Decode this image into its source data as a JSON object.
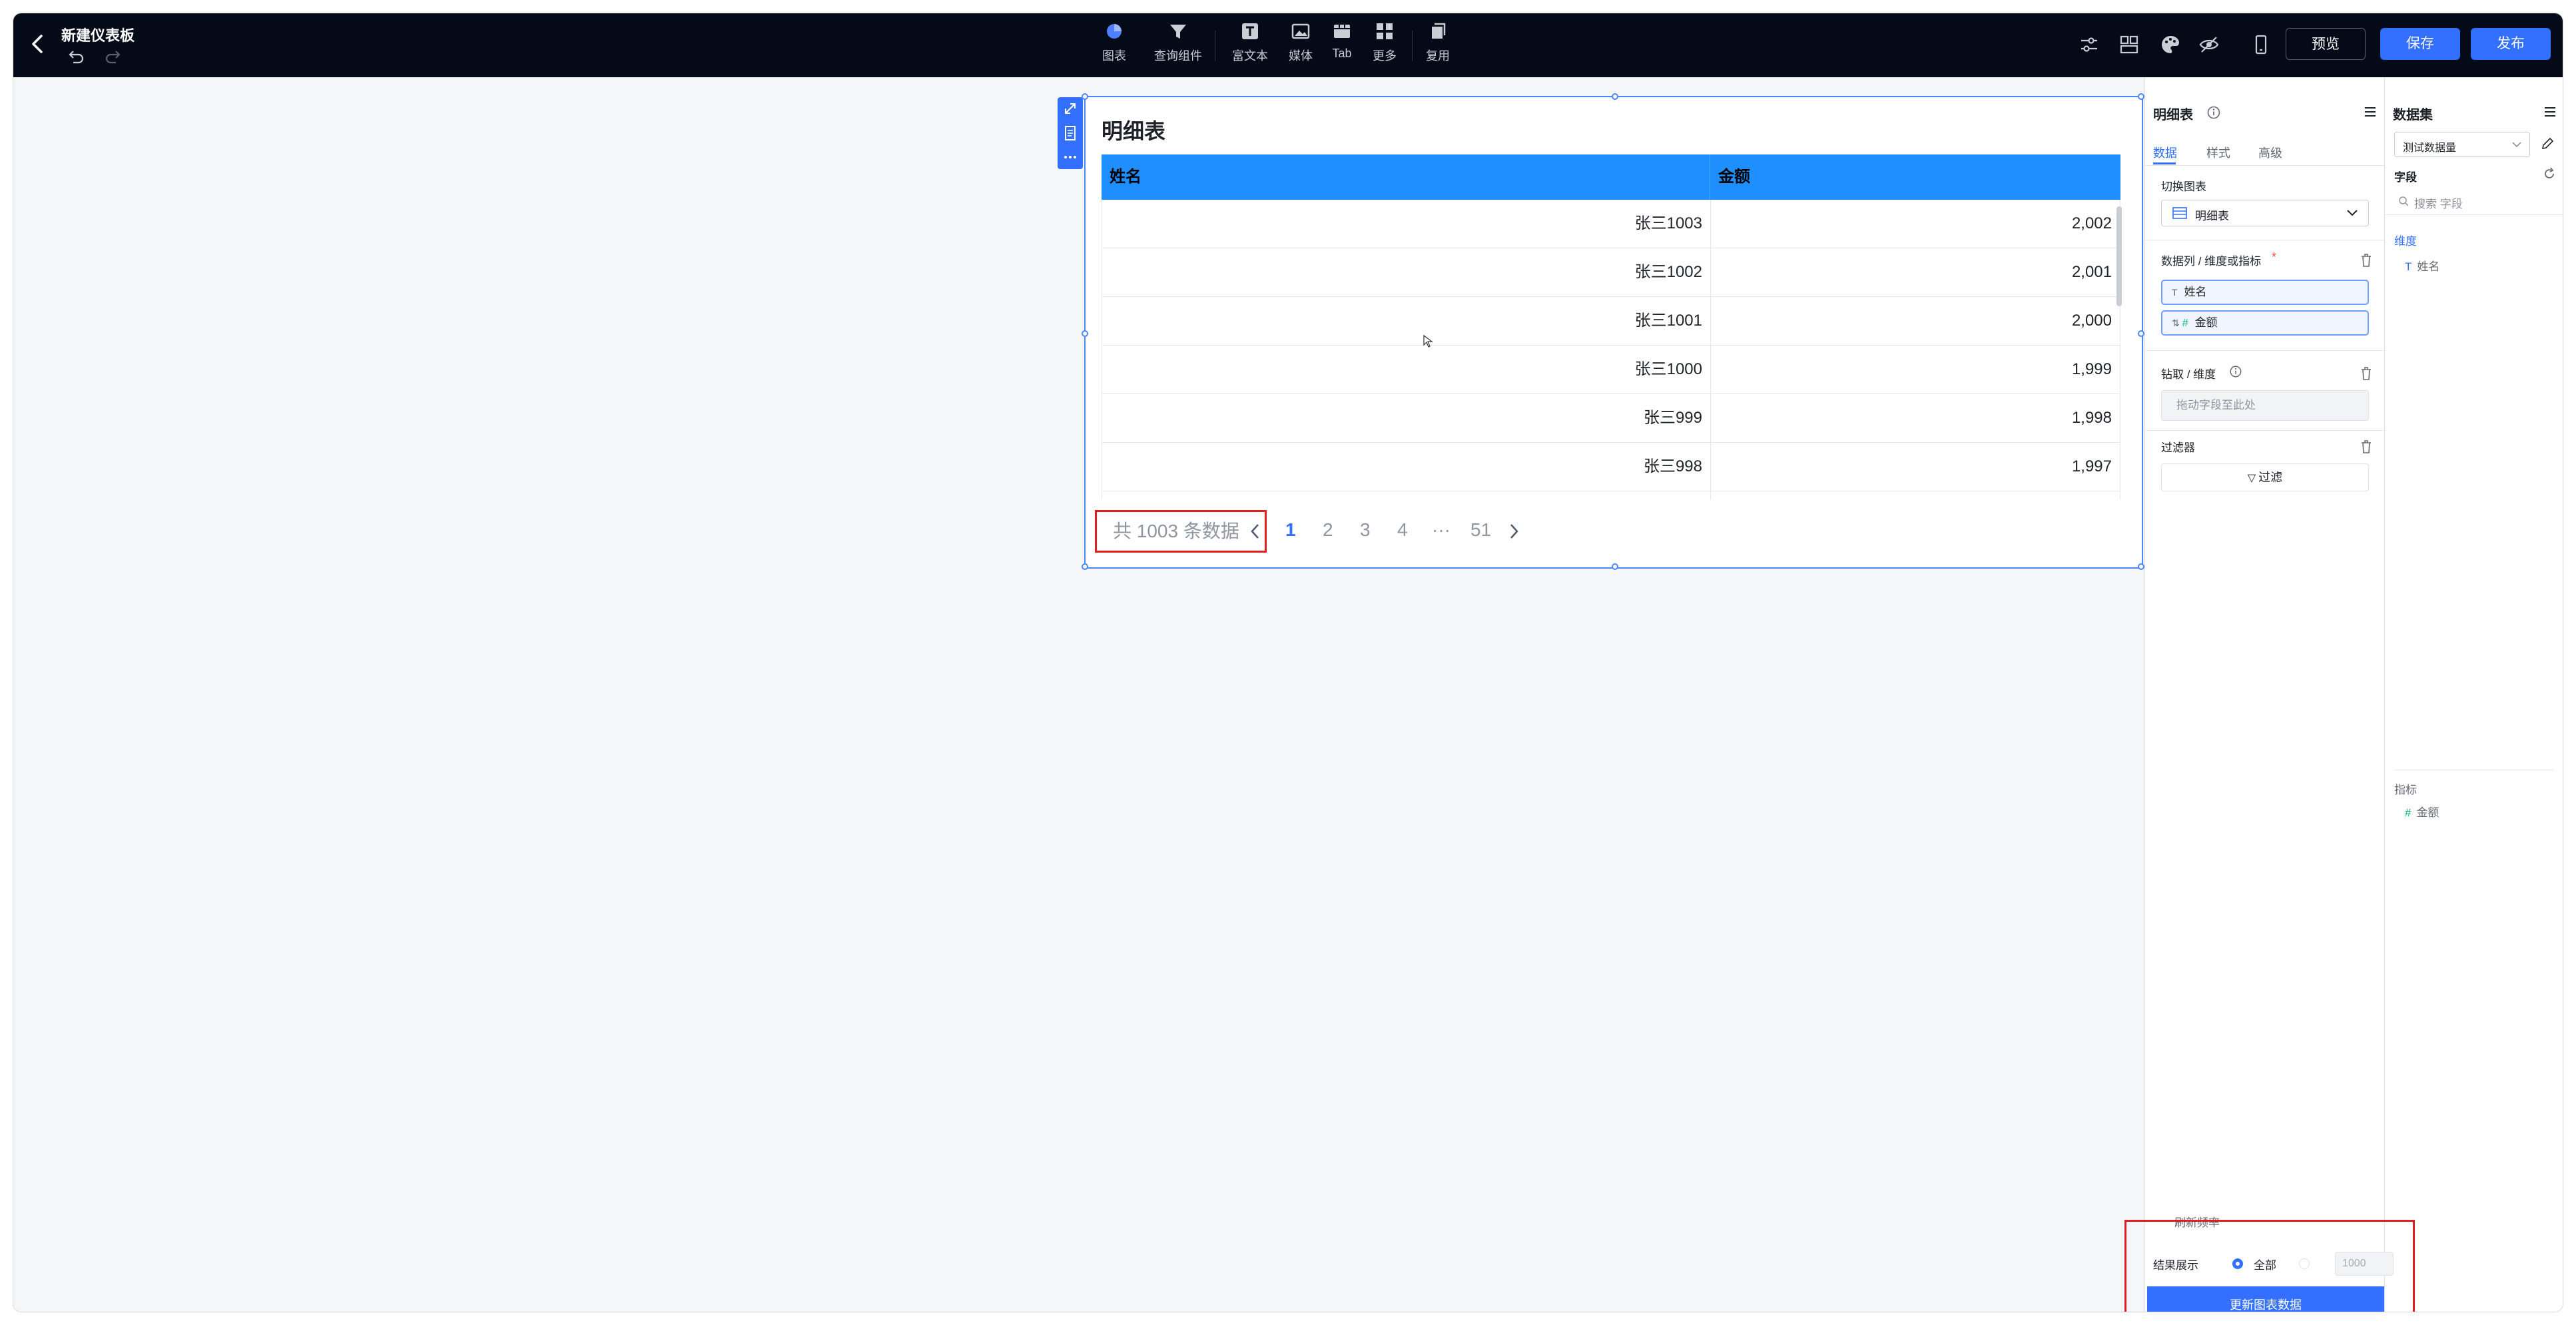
{
  "header": {
    "title": "新建仪表板",
    "toolbar": [
      {
        "label": "图表",
        "icon": "pie-chart-icon"
      },
      {
        "label": "查询组件",
        "icon": "filter-funnel-icon"
      },
      {
        "label": "富文本",
        "icon": "rich-text-icon"
      },
      {
        "label": "媒体",
        "icon": "image-icon"
      },
      {
        "label": "Tab",
        "icon": "tab-icon"
      },
      {
        "label": "更多",
        "icon": "grid-icon"
      },
      {
        "label": "复用",
        "icon": "copy-icon"
      }
    ],
    "preview_label": "预览",
    "save_label": "保存",
    "publish_label": "发布"
  },
  "chart": {
    "title": "明细表",
    "columns": [
      "姓名",
      "金额"
    ],
    "rows": [
      [
        "张三1003",
        "2,002"
      ],
      [
        "张三1002",
        "2,001"
      ],
      [
        "张三1001",
        "2,000"
      ],
      [
        "张三1000",
        "1,999"
      ],
      [
        "张三999",
        "1,998"
      ],
      [
        "张三998",
        "1,997"
      ],
      [
        "",
        ""
      ]
    ],
    "pagination": {
      "total": "共 1003 条数据",
      "pages": [
        "1",
        "2",
        "3",
        "4",
        "···",
        "51"
      ],
      "current": "1"
    }
  },
  "config_panel": {
    "title": "明细表",
    "tabs": [
      "数据",
      "样式",
      "高级"
    ],
    "switch_chart_label": "切换图表",
    "chart_type": "明细表",
    "columns_label": "数据列 / 维度或指标",
    "required_mark": "*",
    "fields": [
      "姓名",
      "金额"
    ],
    "drill_label": "钻取 / 维度",
    "drill_placeholder": "拖动字段至此处",
    "filter_label": "过滤器",
    "filter_button": "过滤",
    "refresh_label": "刷新频率",
    "result_label": "结果展示",
    "result_all": "全部",
    "result_limit_placeholder": "1000",
    "update_button": "更新图表数据"
  },
  "dataset_panel": {
    "title": "数据集",
    "dataset_name": "测试数据量",
    "fields_label": "字段",
    "search_placeholder": "搜索 字段",
    "dimension_label": "维度",
    "dimension_field": "姓名",
    "metric_label": "指标",
    "metric_field": "金额"
  },
  "colors": {
    "topbar_bg": "#050a18",
    "accent": "#3370ff",
    "table_header": "#1f8fff",
    "highlight_border": "#e02020"
  }
}
